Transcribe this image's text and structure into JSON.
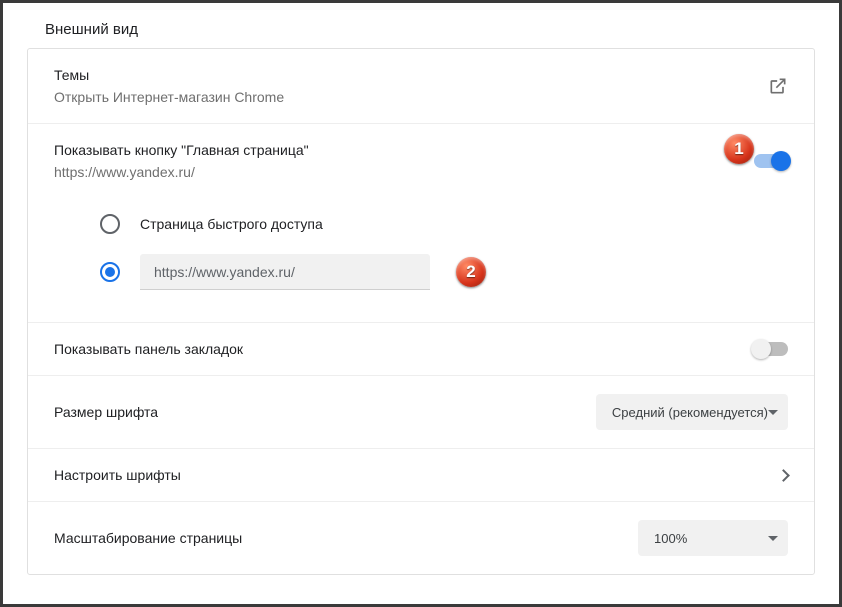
{
  "section_title": "Внешний вид",
  "themes": {
    "title": "Темы",
    "subtitle": "Открыть Интернет-магазин Chrome"
  },
  "home_button": {
    "label": "Показывать кнопку \"Главная страница\"",
    "url_display": "https://www.yandex.ru/",
    "enabled": true,
    "options": {
      "quick_access_label": "Страница быстрого доступа",
      "custom_url_value": "https://www.yandex.ru/",
      "selected": "custom_url"
    }
  },
  "bookmarks_bar": {
    "label": "Показывать панель закладок",
    "enabled": false
  },
  "font_size": {
    "label": "Размер шрифта",
    "value": "Средний (рекомендуется)"
  },
  "customize_fonts": {
    "label": "Настроить шрифты"
  },
  "page_zoom": {
    "label": "Масштабирование страницы",
    "value": "100%"
  },
  "annotations": {
    "one": "1",
    "two": "2"
  }
}
